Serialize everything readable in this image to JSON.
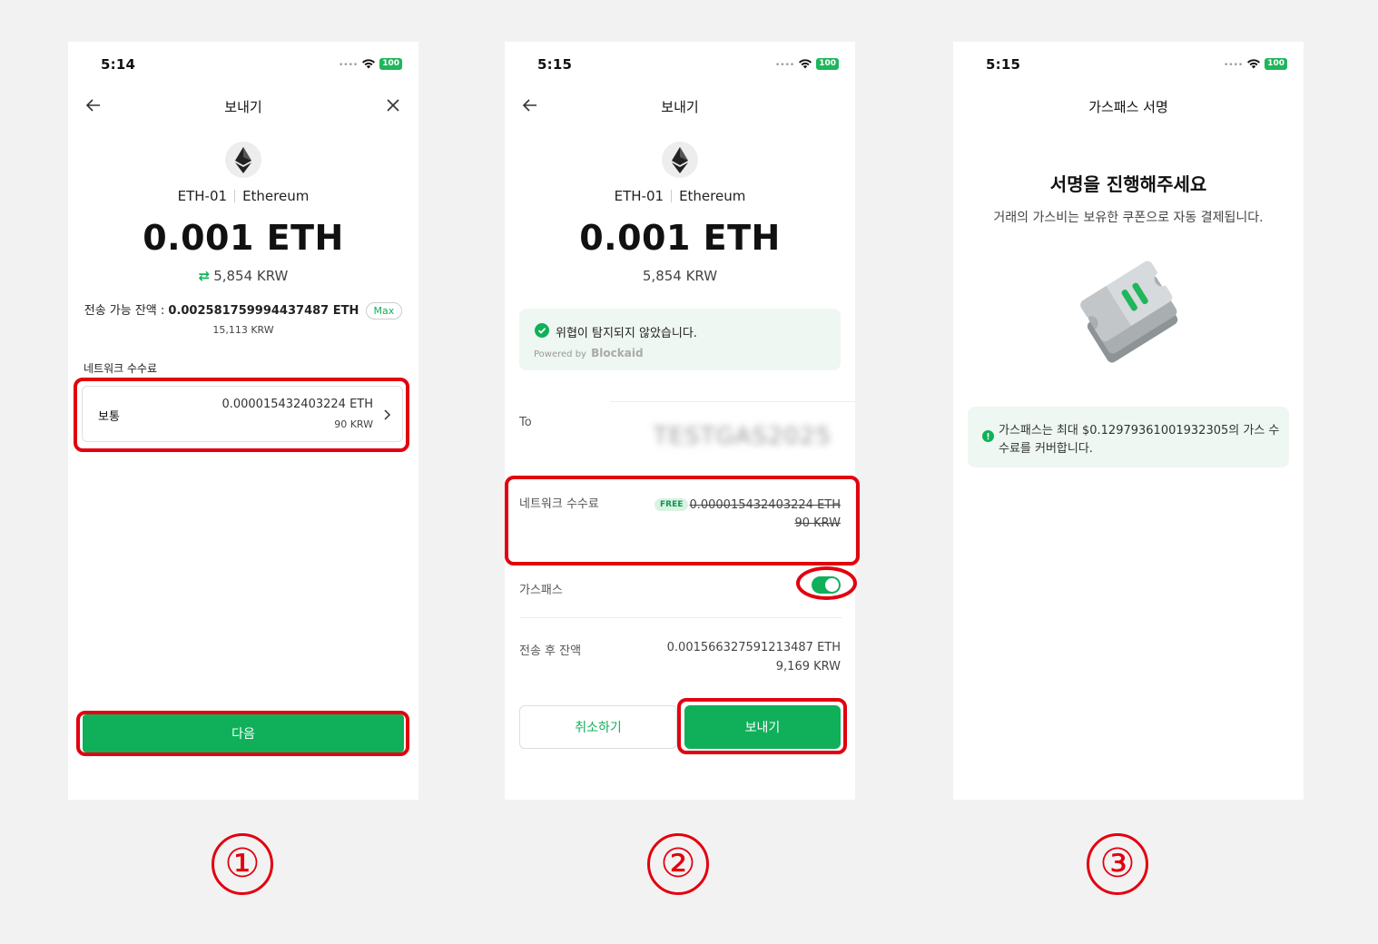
{
  "colors": {
    "accent": "#10b05a",
    "highlight": "#e3000f",
    "background": "#f2f2f2"
  },
  "step_labels": [
    "①",
    "②",
    "③"
  ],
  "screen1": {
    "time": "5:14",
    "battery": "100",
    "title": "보내기",
    "asset_code": "ETH-01",
    "asset_name": "Ethereum",
    "amount": "0.001 ETH",
    "amount_krw": "5,854 KRW",
    "available_label": "전송 가능 잔액 : ",
    "available_value": "0.002581759994437487 ETH",
    "max_label": "Max",
    "available_krw": "15,113 KRW",
    "fee_section_label": "네트워크 수수료",
    "fee_option_label": "보통",
    "fee_eth": "0.000015432403224 ETH",
    "fee_krw": "90 KRW",
    "next_button": "다음"
  },
  "screen2": {
    "time": "5:15",
    "battery": "100",
    "title": "보내기",
    "asset_code": "ETH-01",
    "asset_name": "Ethereum",
    "amount": "0.001 ETH",
    "amount_krw": "5,854 KRW",
    "security_message": "위협이 탐지되지 않았습니다.",
    "powered_by": "Powered by",
    "powered_brand": "Blockaid",
    "to_label": "To",
    "to_value_blurred": "TESTGAS2025",
    "fee_label": "네트워크 수수료",
    "free_badge": "FREE",
    "fee_eth": "0.000015432403224 ETH",
    "fee_krw": "90 KRW",
    "gaspass_label": "가스패스",
    "gaspass_enabled": true,
    "balance_after_label": "전송 후 잔액",
    "balance_after_eth": "0.001566327591213487 ETH",
    "balance_after_krw": "9,169 KRW",
    "cancel_button": "취소하기",
    "send_button": "보내기"
  },
  "screen3": {
    "time": "5:15",
    "battery": "100",
    "title": "가스패스 서명",
    "heading": "서명을 진행해주세요",
    "subtext": "거래의 가스비는 보유한 쿠폰으로 자동 결제됩니다.",
    "info_line1": "가스패스는 최대 $0.129793610019323​05의 가스 수",
    "info_line2": "수료를 커버합니다."
  }
}
